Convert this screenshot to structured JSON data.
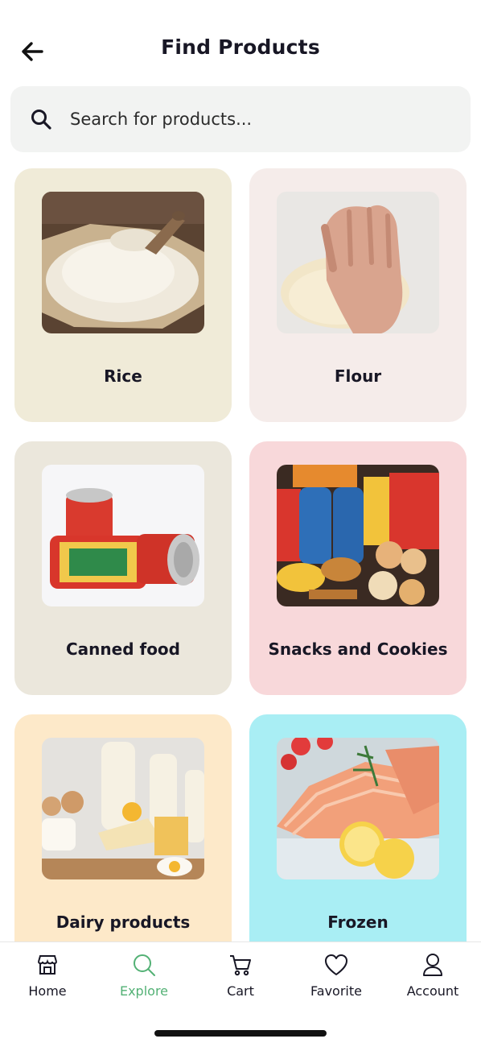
{
  "header": {
    "title": "Find Products"
  },
  "search": {
    "placeholder": "Search for products..."
  },
  "categories": [
    {
      "label": "Rice",
      "bg": "#f0ebd8",
      "image": "rice-image"
    },
    {
      "label": "Flour",
      "bg": "#f5ecea",
      "image": "flour-dough-image"
    },
    {
      "label": "Canned food",
      "bg": "#ebe7dc",
      "image": "canned-mackerel-image"
    },
    {
      "label": "Snacks and Cookies",
      "bg": "#f8d8da",
      "image": "snacks-cookies-image"
    },
    {
      "label": "Dairy products",
      "bg": "#fde9c9",
      "image": "dairy-products-image"
    },
    {
      "label": "Frozen",
      "bg": "#a9eef4",
      "image": "frozen-salmon-image"
    }
  ],
  "nav": {
    "items": [
      {
        "label": "Home",
        "icon": "store-icon",
        "active": false
      },
      {
        "label": "Explore",
        "icon": "search-icon",
        "active": true
      },
      {
        "label": "Cart",
        "icon": "cart-icon",
        "active": false
      },
      {
        "label": "Favorite",
        "icon": "heart-icon",
        "active": false
      },
      {
        "label": "Account",
        "icon": "user-icon",
        "active": false
      }
    ],
    "active_color": "#53b175"
  }
}
